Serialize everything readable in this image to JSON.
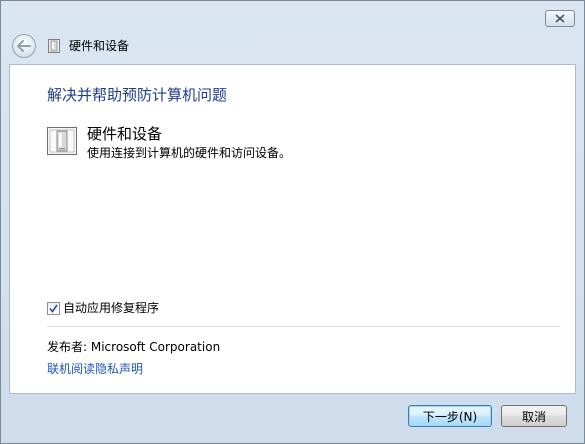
{
  "window": {
    "close_label": "✕"
  },
  "nav": {
    "title": "硬件和设备",
    "back_icon": "back-arrow-icon",
    "title_icon": "hardware-device-icon"
  },
  "main": {
    "heading": "解决并帮助预防计算机问题",
    "task": {
      "title": "硬件和设备",
      "description": "使用连接到计算机的硬件和访问设备。",
      "icon": "hardware-device-icon"
    },
    "auto_fix": {
      "label": "自动应用修复程序",
      "checked": true
    },
    "publisher": "发布者:  Microsoft Corporation",
    "privacy_link": "联机阅读隐私声明"
  },
  "buttons": {
    "next": "下一步(N)",
    "cancel": "取消"
  },
  "colors": {
    "heading": "#1e3c92",
    "link": "#1e57b3",
    "frame": "#dbe6f2"
  }
}
